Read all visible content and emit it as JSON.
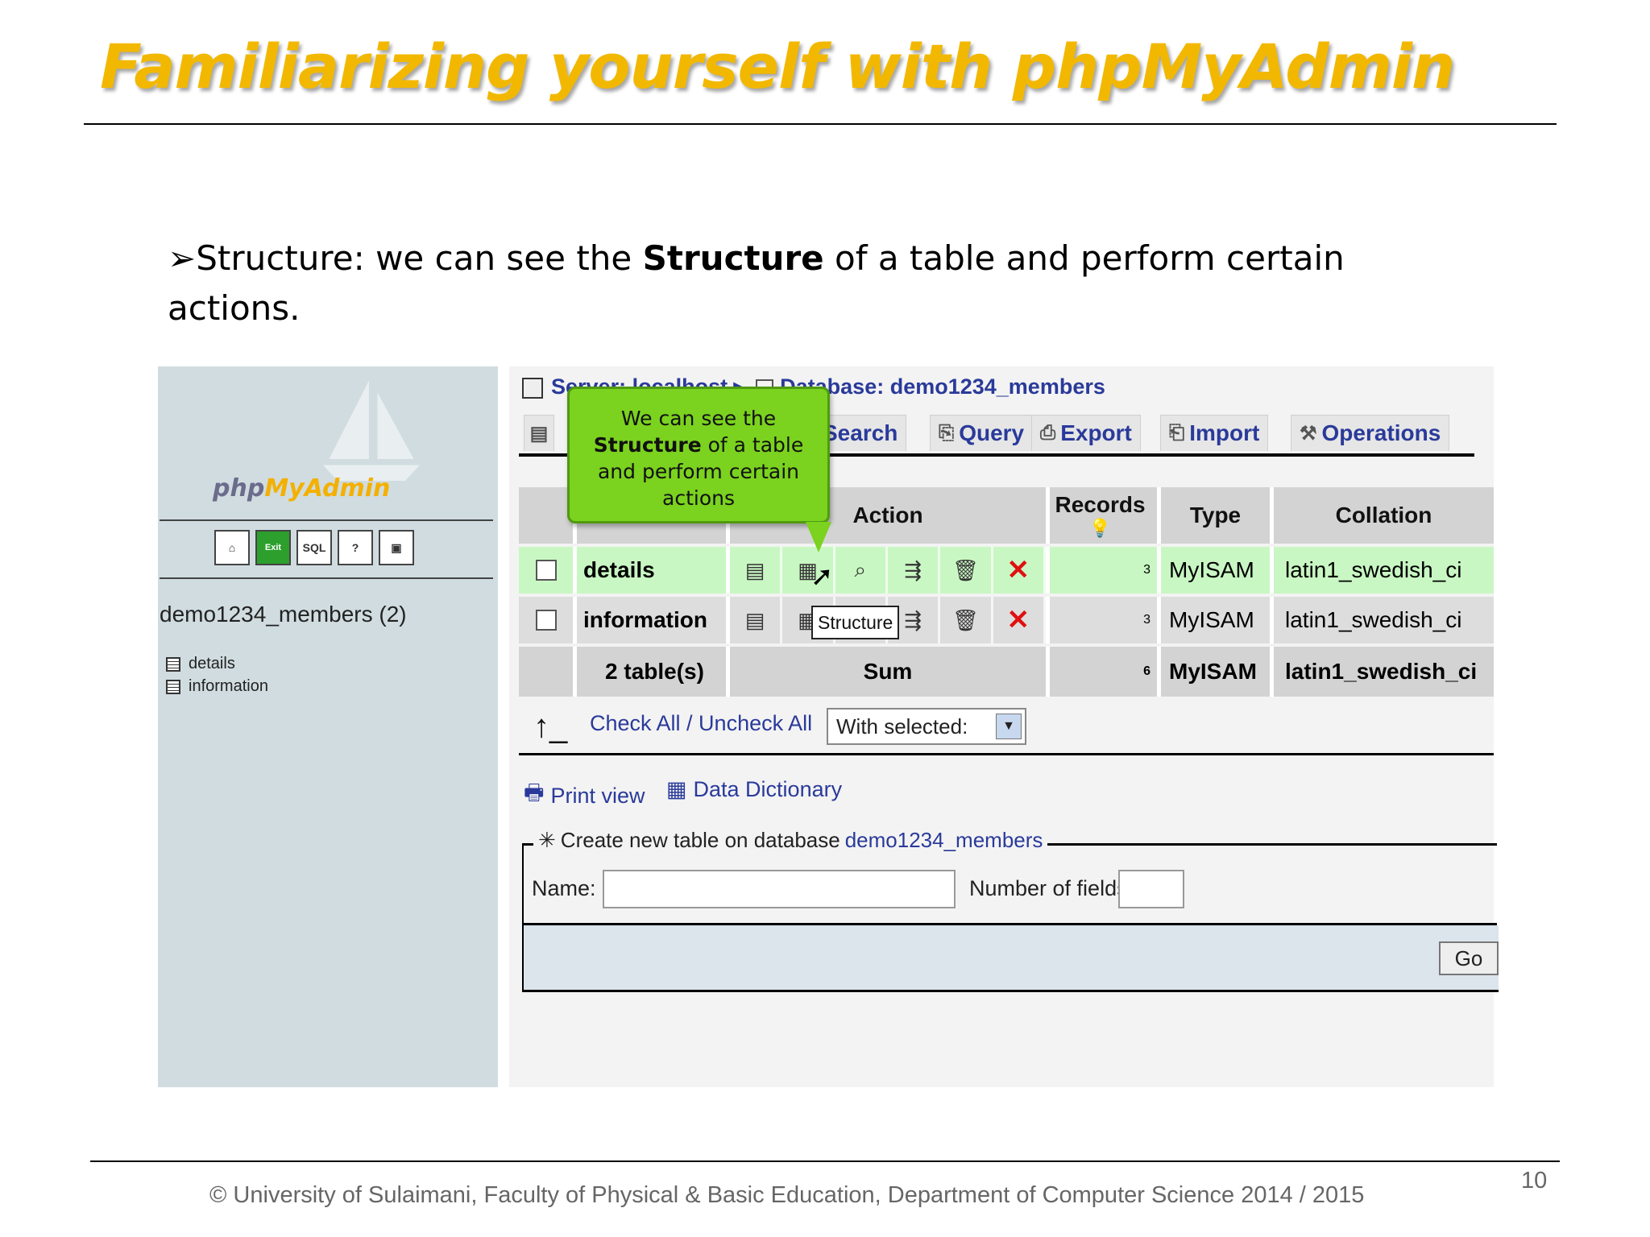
{
  "slide": {
    "title": "Familiarizing yourself with phpMyAdmin",
    "bullet_prefix": "Structure: we can see  the ",
    "bullet_bold": "Structure",
    "bullet_suffix": " of a table and perform certain actions.",
    "footer": "© University of Sulaimani, Faculty of Physical & Basic Education, Department of Computer Science  2014 / 2015",
    "page_number": "10"
  },
  "pma": {
    "logo_php": "php",
    "logo_my": "MyAdmin",
    "home_icons": [
      "home-icon",
      "exit-icon",
      "sql-icon",
      "help-icon",
      "query-window-icon"
    ],
    "home_icon_text": {
      "exit": "Exit",
      "sql": "SQL"
    },
    "left_db": "demo1234_members (2)",
    "left_tables": [
      "details",
      "information"
    ],
    "breadcrumb": {
      "server": "Server: localhost",
      "db": "Database: demo1234_members"
    },
    "tabs": [
      "Search",
      "Query",
      "Export",
      "Import",
      "Operations"
    ],
    "table_headers": {
      "action": "Action",
      "records": "Records",
      "type": "Type",
      "collation": "Collation"
    },
    "rows": [
      {
        "name": "details",
        "records": "3",
        "type": "MyISAM",
        "collation": "latin1_swedish_ci"
      },
      {
        "name": "information",
        "records": "3",
        "type": "MyISAM",
        "collation": "latin1_swedish_ci"
      }
    ],
    "sum_row": {
      "name": "2 table(s)",
      "action": "Sum",
      "records": "6",
      "type": "MyISAM",
      "collation": "latin1_swedish_ci"
    },
    "check_all": "Check All / Uncheck All",
    "with_selected": "With selected:",
    "print_view": "Print view",
    "data_dictionary": "Data Dictionary",
    "create_label": "Create new table on database ",
    "create_db": "demo1234_members",
    "name_label": "Name:",
    "fields_label": "Number of fields:",
    "go": "Go"
  },
  "callout": {
    "line1": "We can see the",
    "line2_bold": "Structure",
    "line2_rest": " of a table",
    "line3": "and perform certain",
    "line4": "actions"
  },
  "tooltip": "Structure"
}
